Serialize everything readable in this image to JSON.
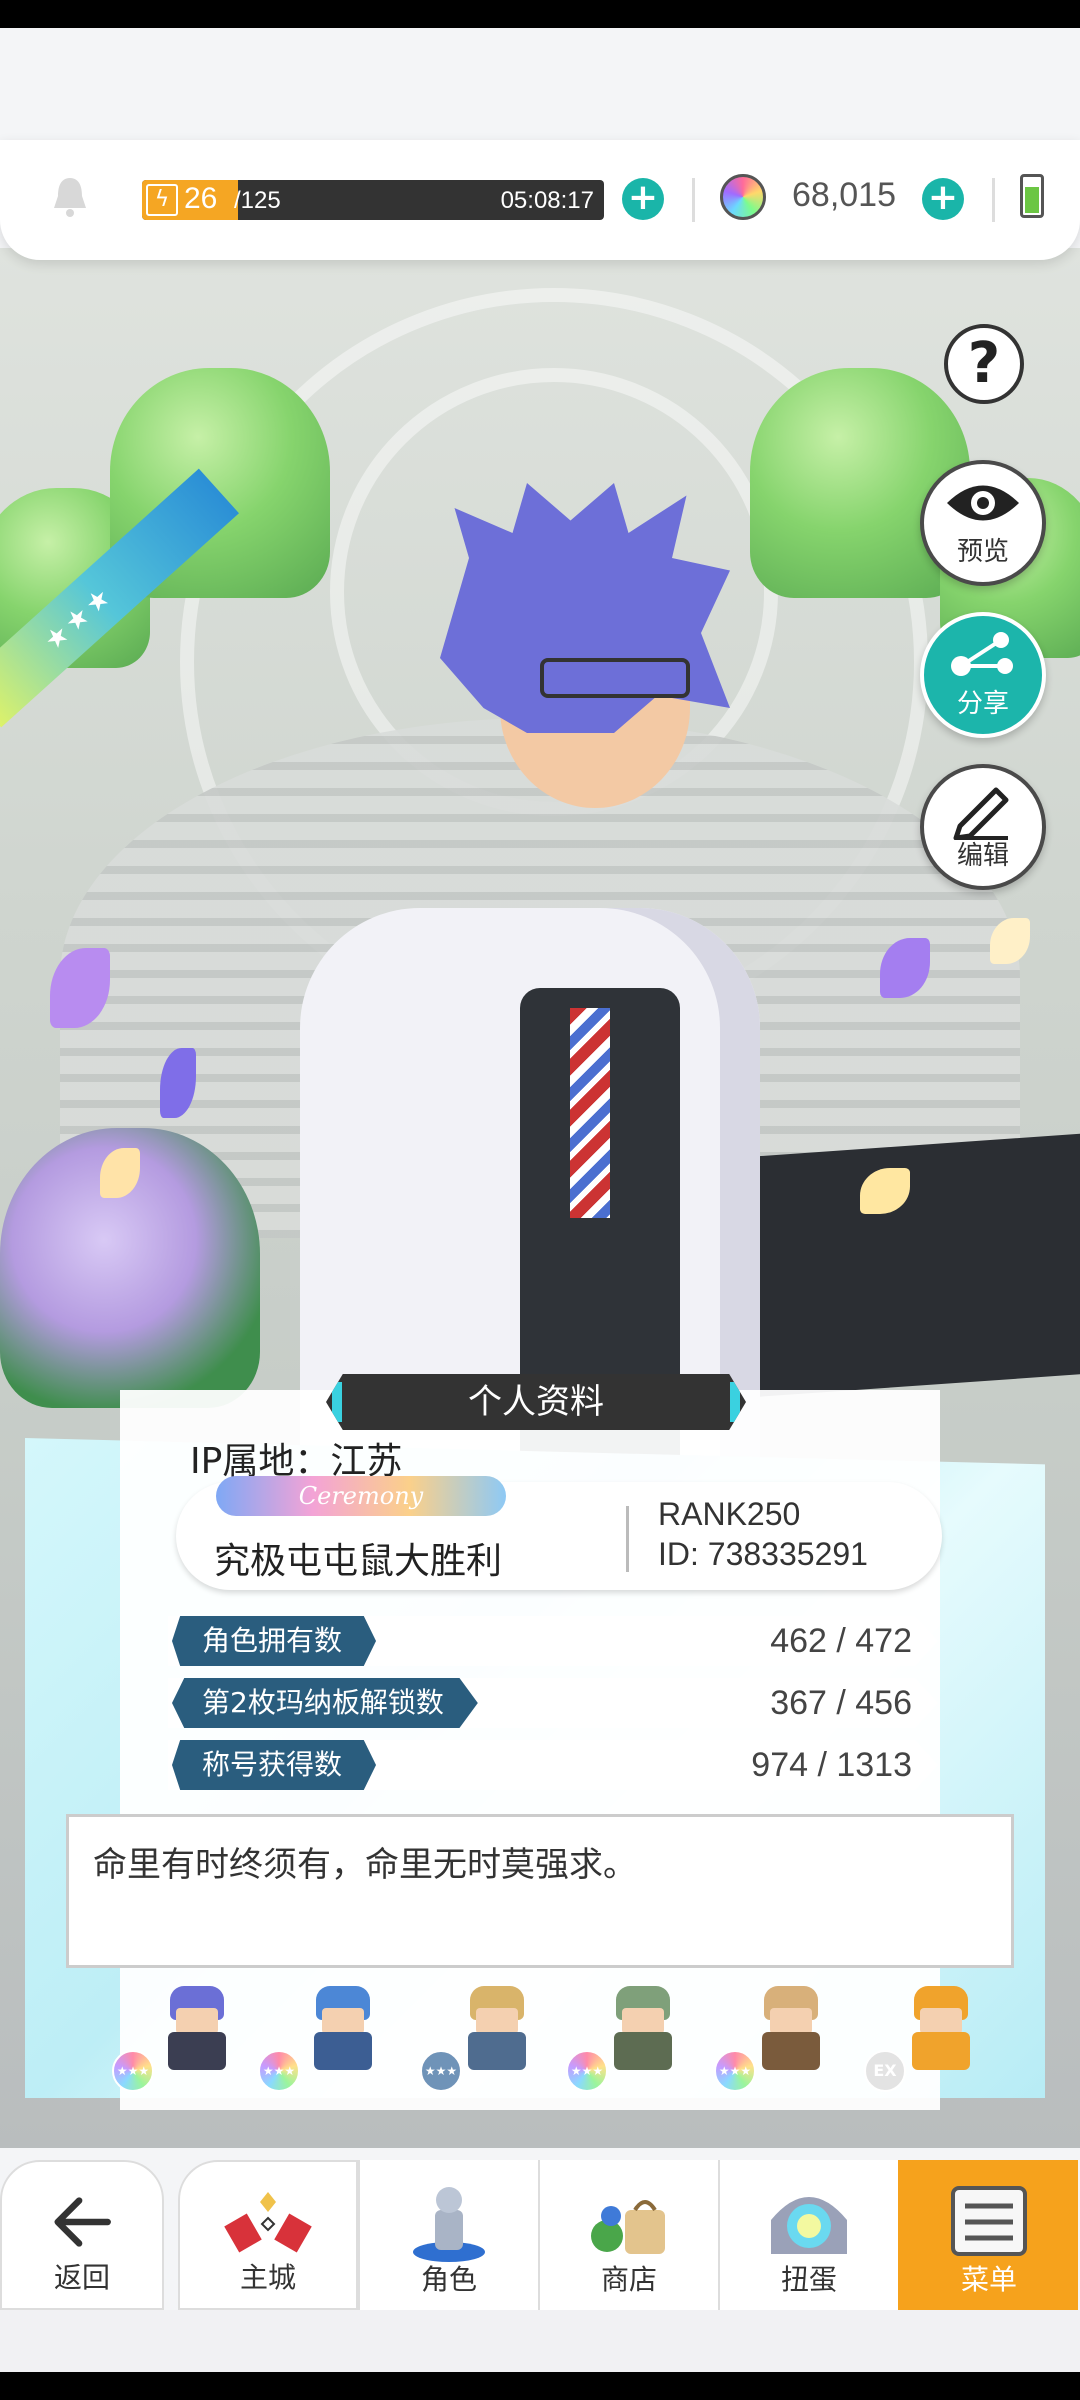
{
  "status": {
    "stamina_current": "26",
    "stamina_max": "/125",
    "stamina_fraction": 0.208,
    "stamina_timer": "05:08:17",
    "gems": "68,015"
  },
  "side_buttons": {
    "help": "?",
    "preview": "预览",
    "share": "分享",
    "edit": "编辑"
  },
  "rarity_ribbon": "★★★",
  "profile": {
    "title": "个人资料",
    "ip_location": "IP属地：江苏",
    "badge": "Ceremony",
    "player_name": "究极屯屯鼠大胜利",
    "rank": "RANK250",
    "id": "ID: 738335291",
    "stats": [
      {
        "label": "角色拥有数",
        "value": "462 / 472"
      },
      {
        "label": "第2枚玛纳板解锁数",
        "value": "367 / 456"
      },
      {
        "label": "称号获得数",
        "value": "974 / 1313"
      }
    ],
    "motto": "命里有时终须有，命里无时莫强求。",
    "team_rarity": [
      "★★★",
      "★★★",
      "★★★",
      "★★★",
      "★★★",
      "EX"
    ]
  },
  "nav": {
    "back": "返回",
    "items": [
      "主城",
      "角色",
      "商店",
      "扭蛋",
      "菜单"
    ]
  },
  "colors": {
    "accent_teal": "#1ab5a9",
    "stamina_orange": "#f5a623",
    "menu_orange": "#f6a21c",
    "stat_label": "#2a5d7e"
  }
}
